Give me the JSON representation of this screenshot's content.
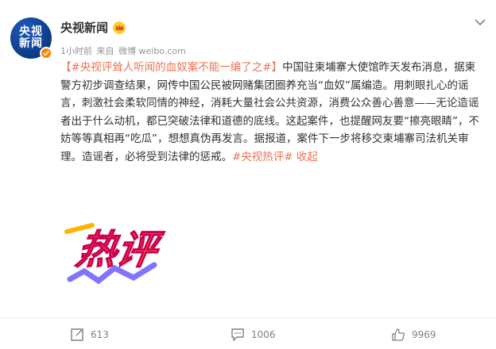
{
  "post": {
    "author": {
      "name": "央视新闻",
      "avatar_line1": "央视",
      "avatar_line2": "新闻",
      "verified_color": "#ff8200"
    },
    "meta": {
      "time": "1小时前",
      "source_prefix": "来自",
      "source": "微博 weibo.com"
    },
    "content": {
      "tag_title": "【#央视评耸人听闻的血奴案不能一编了之#】",
      "text": "中国驻柬埔寨大使馆昨天发布消息，据柬警方初步调查结果，网传中国公民被网赌集团圈养充当“血奴”属编造。用刺眼扎心的谣言，刺激社会柔软同情的神经，消耗大量社会公共资源，消费公众善心善意——无论造谣者出于什么动机，都已突破法律和道德的底线。这起案件，也提醒网友要“擦亮眼睛”，不妨等等真相再“吃瓜”，想想真伪再发言。据报道，案件下一步将移交柬埔寨司法机关审理。造谣者，必将受到法律的惩戒。",
      "end_tag": "#央视热评#",
      "collapse": "收起",
      "accent_color": "#eb7350"
    },
    "image": {
      "text": "热评",
      "colors": [
        "#ff2d6f",
        "#ffb400",
        "#6a5cff"
      ]
    },
    "actions": {
      "repost_icon": "repost-icon",
      "repost_count": "613",
      "comment_icon": "comment-icon",
      "comment_count": "1006",
      "like_icon": "like-icon",
      "like_count": "9969"
    }
  }
}
